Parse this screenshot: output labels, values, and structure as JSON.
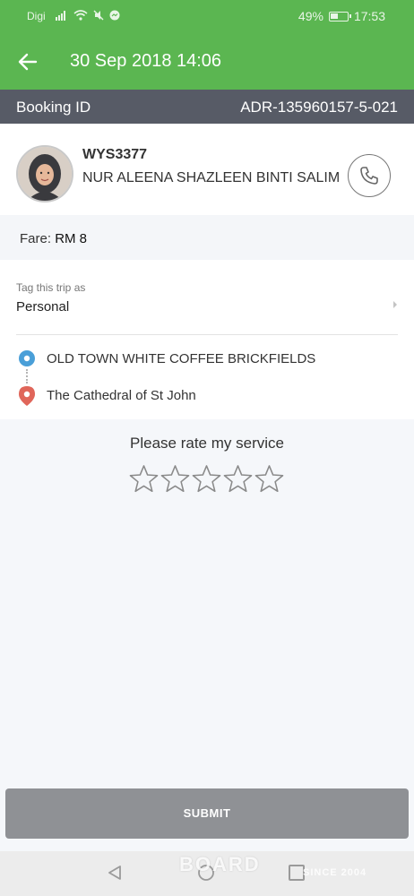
{
  "status_bar": {
    "carrier": "Digi",
    "battery": "49%",
    "time": "17:53"
  },
  "app_bar": {
    "title": "30 Sep 2018 14:06"
  },
  "booking": {
    "label": "Booking ID",
    "id": "ADR-135960157-5-021"
  },
  "driver": {
    "plate": "WYS3377",
    "name": "NUR ALEENA SHAZLEEN BINTI SALIM"
  },
  "fare": {
    "label": "Fare:",
    "amount": "RM 8"
  },
  "tag": {
    "label": "Tag this trip as",
    "value": "Personal"
  },
  "route": {
    "pickup": "OLD TOWN WHITE COFFEE BRICKFIELDS",
    "dropoff": "The Cathedral of St John"
  },
  "rating": {
    "prompt": "Please rate my service",
    "stars_total": 5,
    "stars_selected": 0
  },
  "submit": {
    "label": "SUBMIT"
  },
  "watermark": {
    "text": "BOARD",
    "since": "SINCE 2004"
  },
  "colors": {
    "accent": "#5bb651",
    "booking_bar": "#575b66",
    "submit_disabled": "#8f9195"
  }
}
